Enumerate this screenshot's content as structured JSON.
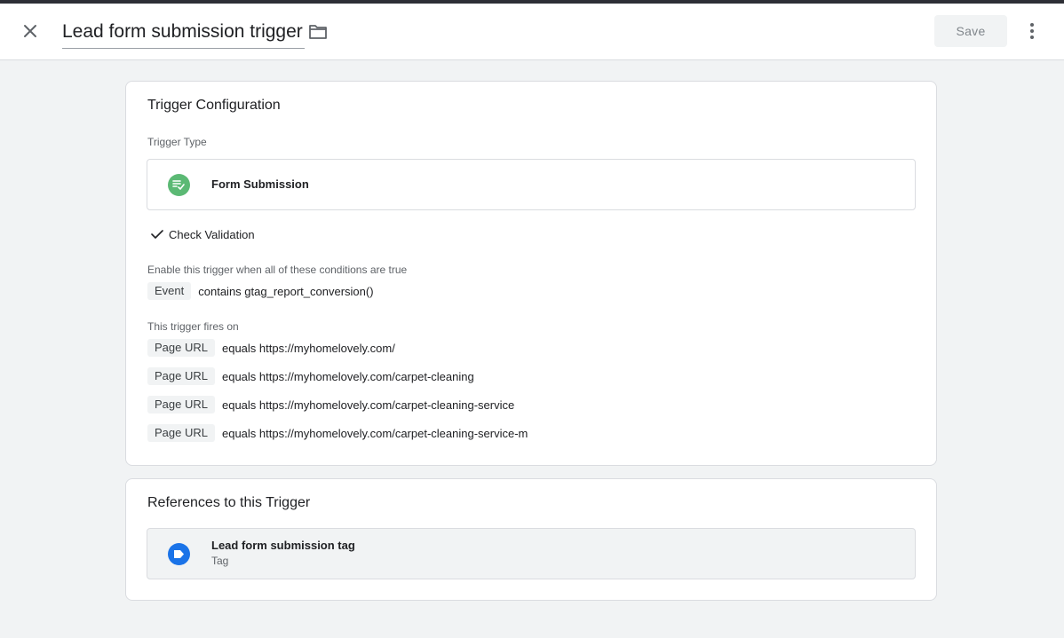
{
  "header": {
    "title": "Lead form submission trigger",
    "save_label": "Save",
    "close_icon": "close-icon",
    "folder_icon": "folder-icon",
    "more_icon": "more-vert-icon"
  },
  "trigger_config": {
    "title": "Trigger Configuration",
    "type_label": "Trigger Type",
    "type_name": "Form Submission",
    "type_icon": "form-submission-icon",
    "type_color": "#5bb974",
    "check_validation": "Check Validation",
    "enable_label": "Enable this trigger when all of these conditions are true",
    "enable_conditions": [
      {
        "variable": "Event",
        "text": "contains gtag_report_conversion()"
      }
    ],
    "fires_label": "This trigger fires on",
    "fires_conditions": [
      {
        "variable": "Page URL",
        "text": "equals https://myhomelovely.com/"
      },
      {
        "variable": "Page URL",
        "text": "equals https://myhomelovely.com/carpet-cleaning"
      },
      {
        "variable": "Page URL",
        "text": "equals https://myhomelovely.com/carpet-cleaning-service"
      },
      {
        "variable": "Page URL",
        "text": "equals https://myhomelovely.com/carpet-cleaning-service-m"
      }
    ]
  },
  "references": {
    "title": "References to this Trigger",
    "items": [
      {
        "name": "Lead form submission tag",
        "kind": "Tag",
        "icon": "tag-icon",
        "color": "#1a73e8"
      }
    ]
  }
}
